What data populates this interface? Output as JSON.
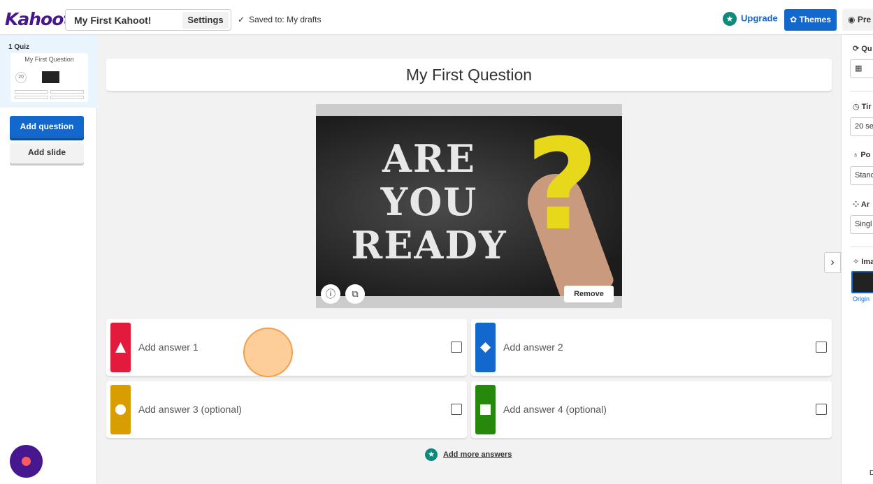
{
  "header": {
    "logo": "Kahoot!",
    "kahoot_title": "My First Kahoot!",
    "settings_label": "Settings",
    "saved_status": "Saved to: My drafts",
    "upgrade_label": "Upgrade",
    "themes_label": "Themes",
    "preview_label": "Pre"
  },
  "sidebar": {
    "slide_label": "1 Quiz",
    "slide_title": "My First Question",
    "slide_timer": "20",
    "add_question": "Add question",
    "add_slide": "Add slide"
  },
  "question": {
    "title": "My First Question",
    "image_text": "ARE YOU READY",
    "remove_label": "Remove"
  },
  "answers": [
    {
      "placeholder": "Add answer 1",
      "color": "#e21b3c",
      "shape": "triangle-icon"
    },
    {
      "placeholder": "Add answer 2",
      "color": "#1368ce",
      "shape": "diamond-icon"
    },
    {
      "placeholder": "Add answer 3 (optional)",
      "color": "#d89e00",
      "shape": "circle-icon"
    },
    {
      "placeholder": "Add answer 4 (optional)",
      "color": "#26890c",
      "shape": "square-icon"
    }
  ],
  "more_answers": "Add more answers",
  "right_panel": {
    "question_type_label": "Qu",
    "time_limit_label": "Tir",
    "time_limit_value": "20 se",
    "points_label": "Po",
    "points_value": "Stanc",
    "answer_options_label": "Ar",
    "answer_options_value": "Singl",
    "image_label": "Ima",
    "image_original": "Origin",
    "bottom_text": "D"
  }
}
